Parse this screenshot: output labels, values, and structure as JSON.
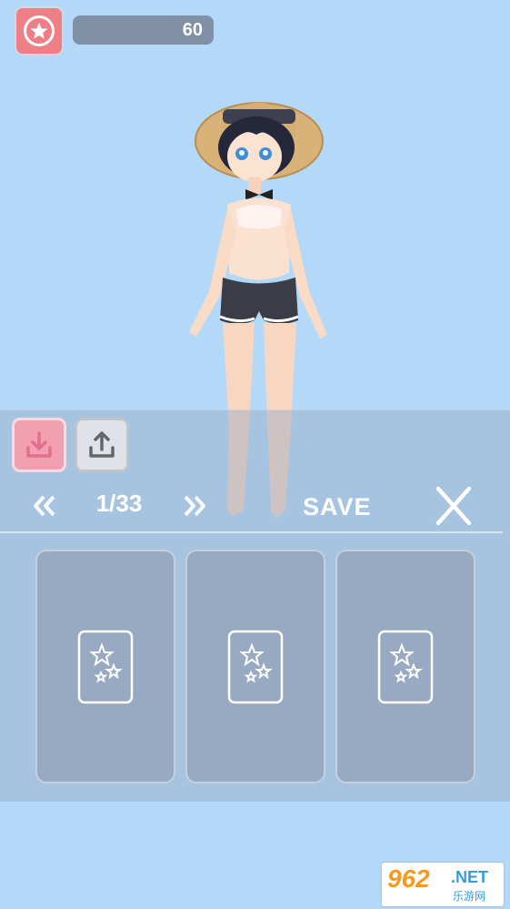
{
  "hud": {
    "score": "60",
    "badge_icon": "star-icon"
  },
  "toolbar": {
    "download_icon": "download-icon",
    "upload_icon": "upload-icon"
  },
  "pager": {
    "prev_icon": "double-chevron-left-icon",
    "page_text": "1/33",
    "next_icon": "double-chevron-right-icon"
  },
  "actions": {
    "save_label": "SAVE",
    "close_icon": "close-icon"
  },
  "slots": [
    {
      "icon": "card-stars-icon"
    },
    {
      "icon": "card-stars-icon"
    },
    {
      "icon": "card-stars-icon"
    }
  ],
  "watermark": {
    "number": "962",
    "domain": ".NET",
    "subtitle": "乐游网"
  },
  "colors": {
    "background": "#b3d8f8",
    "accent_pink": "#ef7f86",
    "panel": "#98aac2"
  }
}
